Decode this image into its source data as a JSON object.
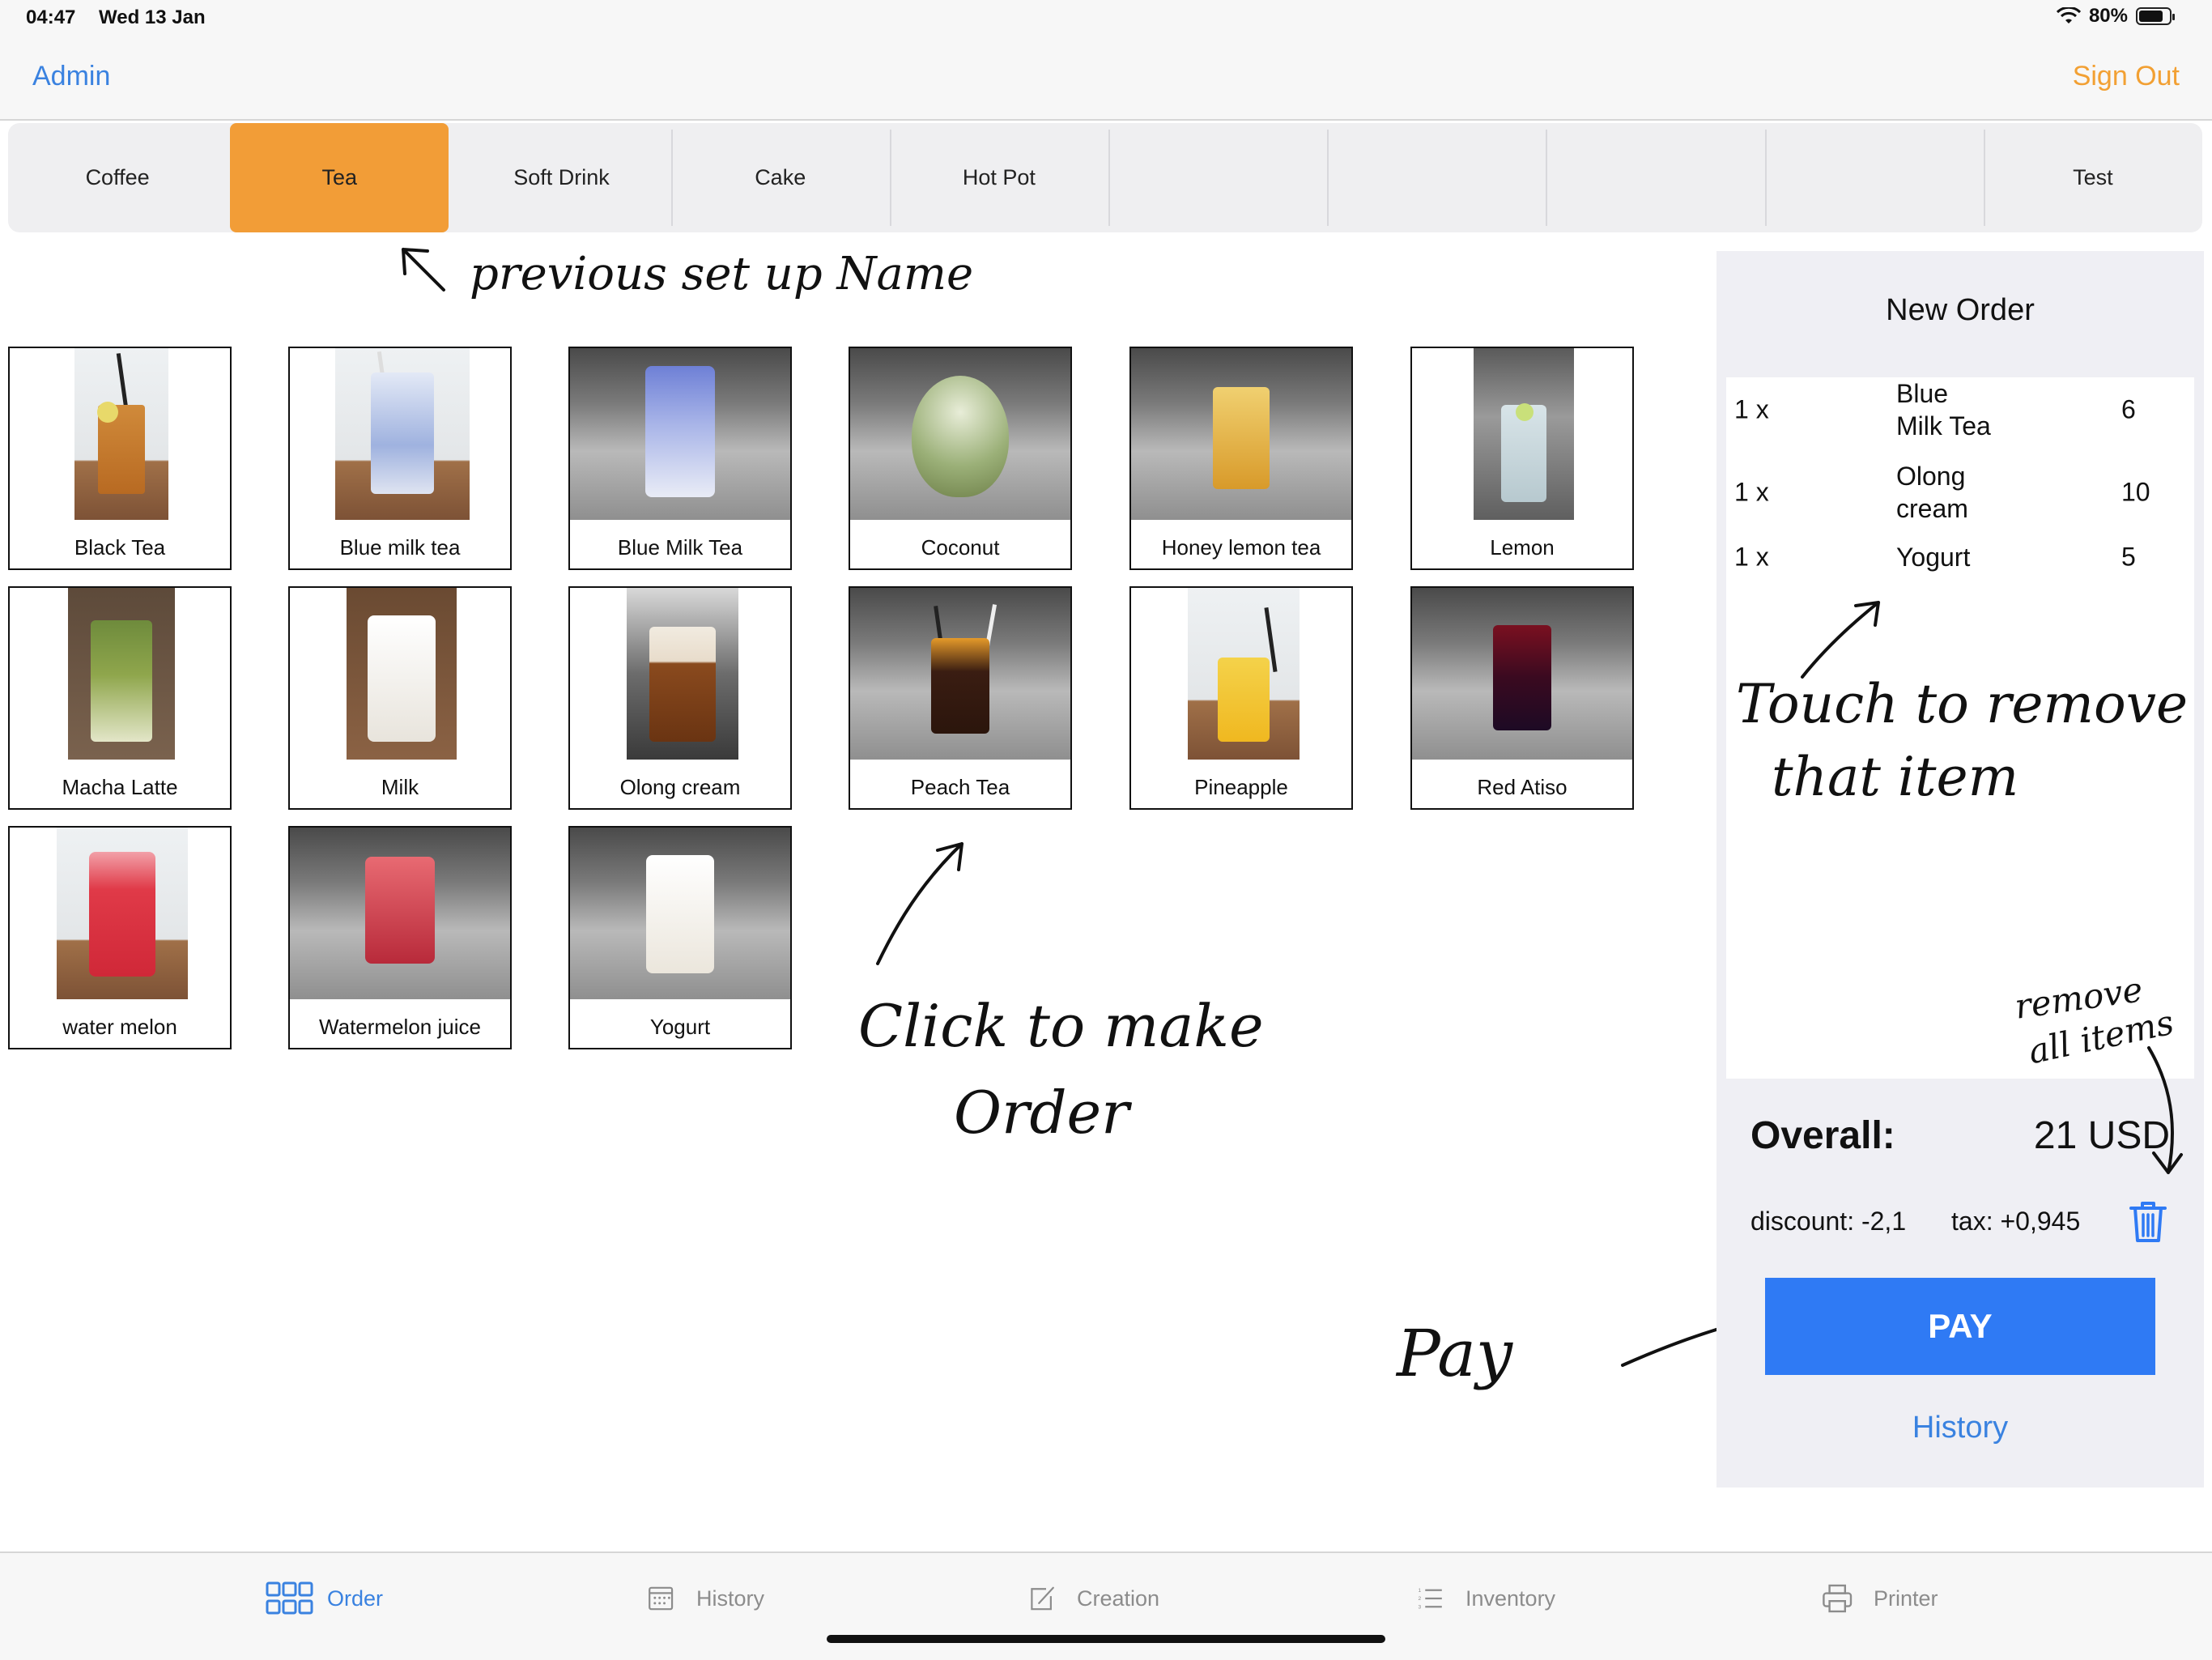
{
  "status_bar": {
    "time": "04:47",
    "date": "Wed 13 Jan",
    "battery_label": "80%",
    "battery_level": 0.8
  },
  "nav": {
    "left": "Admin",
    "right": "Sign Out"
  },
  "categories": [
    "Coffee",
    "Tea",
    "Soft Drink",
    "Cake",
    "Hot Pot",
    "",
    "",
    "",
    "",
    "Test"
  ],
  "active_category": "Tea",
  "menu_items": [
    "Black Tea",
    "Blue milk tea",
    "Blue Milk Tea",
    "Coconut",
    "Honey lemon tea",
    "Lemon",
    "Macha Latte",
    "Milk",
    "Olong cream",
    "Peach Tea",
    "Pineapple",
    "Red Atiso",
    "water melon",
    "Watermelon juice",
    "Yogurt"
  ],
  "annotations": {
    "setup_name": "previous set up Name",
    "click_line1": "Click to make",
    "click_line2": "Order",
    "touch_line1": "Touch to remove",
    "touch_line2": "that item",
    "remove_line1": "remove",
    "remove_line2": "all items",
    "pay": "Pay"
  },
  "order": {
    "title": "New Order",
    "items": [
      {
        "qty": "1 x",
        "name_line1": "Blue",
        "name_line2": "Milk Tea",
        "price": "6"
      },
      {
        "qty": "1 x",
        "name_line1": "Olong",
        "name_line2": "cream",
        "price": "10"
      },
      {
        "qty": "1 x",
        "name_line1": "Yogurt",
        "name_line2": "",
        "price": "5"
      }
    ],
    "overall_label": "Overall:",
    "overall_value": "21 USD",
    "discount": "discount: -2,1",
    "tax": "tax: +0,945",
    "pay_label": "PAY",
    "history_label": "History"
  },
  "tabbar": {
    "items": [
      "Order",
      "History",
      "Creation",
      "Inventory",
      "Printer"
    ],
    "active": "Order"
  },
  "colors": {
    "accent_blue": "#3a82e0",
    "pay_blue": "#2f7af4",
    "orange": "#f29d37",
    "panel_bg": "#efeff4"
  }
}
